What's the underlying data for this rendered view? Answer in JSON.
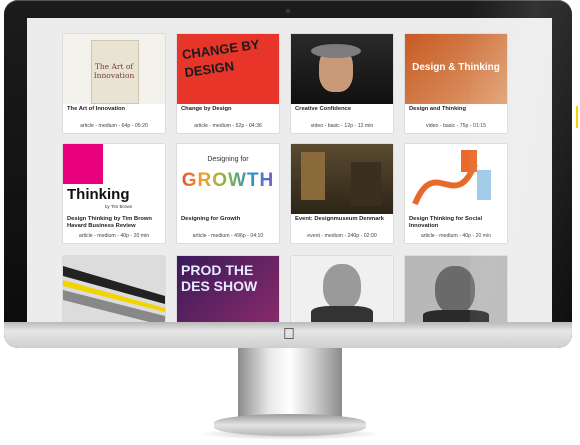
{
  "cards": [
    {
      "title": "The Art of Innovation",
      "meta": "article - medium - 64p - 05:20",
      "thumb_text": "The Art of Innovation"
    },
    {
      "title": "Change by Design",
      "meta": "article - medium - 52p - 04:36",
      "thumb_text": "CHANGE BY DESIGN"
    },
    {
      "title": "Creative Confidence",
      "meta": "video - basic - 12p - 12 min",
      "thumb_text": ""
    },
    {
      "title": "Design and Thinking",
      "meta": "video - basic - 75p - 01:15",
      "thumb_text": "Design & Thinking"
    },
    {
      "title": "Design Thinking by Tim Brown Havard Business Review",
      "meta": "article - medium - 40p - 20 min",
      "thumb_text": "Thinking",
      "thumb_sub": "by Tim Brown"
    },
    {
      "title": "Designing for Growth",
      "meta": "article - medium - 496p - 04:10",
      "thumb_text": "GROWTH",
      "thumb_sub": "Designing for"
    },
    {
      "title": "Event: Designmuseum Denmark",
      "meta": "event - medium - 240p - 02:00",
      "thumb_text": ""
    },
    {
      "title": "Design Thinking for Social Innovation",
      "meta": "article - medium - 40p - 20 min",
      "thumb_text": ""
    },
    {
      "title": "",
      "meta": "",
      "thumb_text": ""
    },
    {
      "title": "",
      "meta": "",
      "thumb_text": "PROD THE DES SHOW"
    },
    {
      "title": "",
      "meta": "",
      "thumb_text": ""
    },
    {
      "title": "",
      "meta": "",
      "thumb_text": ""
    }
  ],
  "colors": {
    "thinking_pink": "#e8007d",
    "change_red": "#e8352a",
    "design_orange": "#d9672a"
  }
}
